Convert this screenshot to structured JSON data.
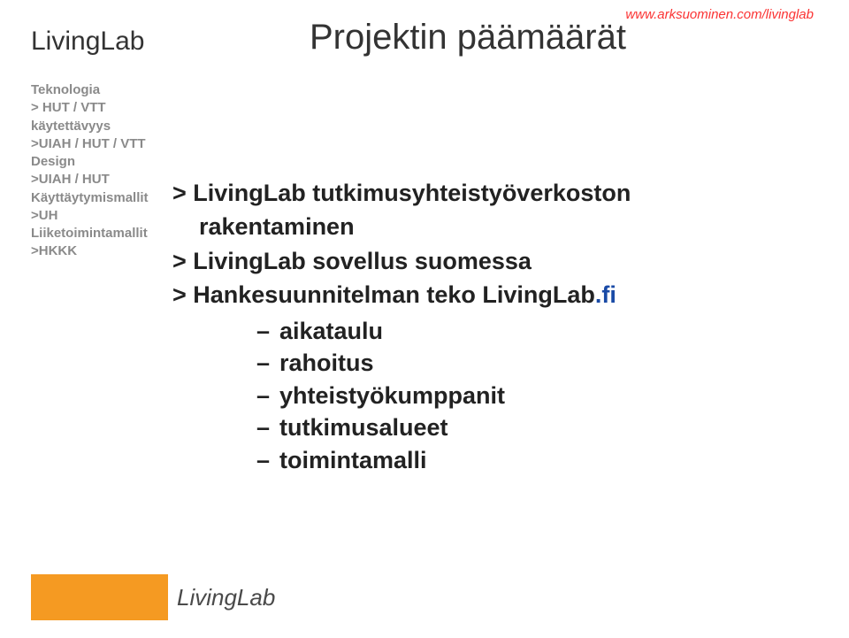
{
  "url": "www.arksuominen.com/livinglab",
  "topTitle": "LivingLab",
  "heading": "Projektin päämäärät",
  "sidebar": {
    "items": [
      "Teknologia",
      "> HUT / VTT",
      "käytettävyys",
      ">UIAH / HUT / VTT",
      "Design",
      ">UIAH / HUT",
      "Käyttäytymismallit",
      ">UH",
      "Liiketoimintamallit",
      ">HKKK"
    ]
  },
  "main": {
    "lines": [
      {
        "text": "> LivingLab tutkimusyhteistyöverkoston",
        "indent": 0
      },
      {
        "text": "rakentaminen",
        "indent": 1
      },
      {
        "text": "> LivingLab sovellus suomessa",
        "indent": 0
      }
    ],
    "line4prefix": "> Hankesuunnitelman teko LivingLab",
    "line4suffix": ".fi",
    "subitems": [
      "aikataulu",
      "rahoitus",
      "yhteistyökumppanit",
      "tutkimusalueet",
      "toimintamalli"
    ]
  },
  "footerTitle": "LivingLab"
}
